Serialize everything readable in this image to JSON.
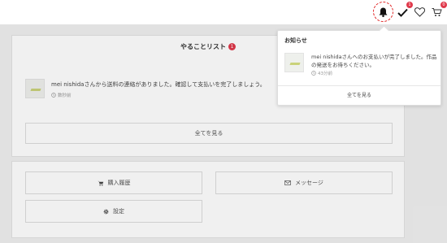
{
  "header": {
    "check_badge": "1",
    "cart_badge": "0"
  },
  "todo": {
    "title": "やることリスト",
    "count": "1",
    "items": [
      {
        "message": "mei nishidaさんから送料の連絡がありました。確認して支払いを完了しましょう。",
        "time": "数秒前"
      }
    ],
    "view_all": "全てを見る"
  },
  "menu": {
    "purchase_history": "購入履歴",
    "messages": "メッセージ",
    "settings": "設定"
  },
  "notifications": {
    "title": "お知らせ",
    "items": [
      {
        "message": "mei nishidaさんへのお支払いが完了しました。作品の発送をお待ちください。",
        "time": "43分前"
      }
    ],
    "view_all": "全てを見る"
  },
  "colors": {
    "badge": "#e0394b",
    "highlight_ring": "#e02020"
  }
}
